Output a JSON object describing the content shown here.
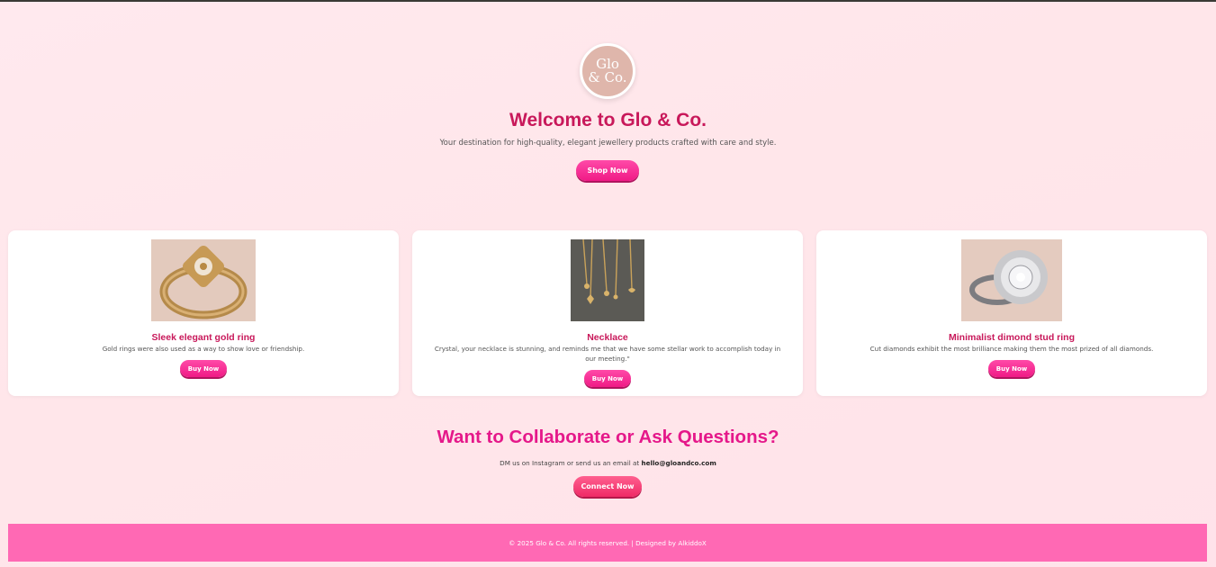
{
  "logo": {
    "line1": "Glo",
    "line2": "& Co."
  },
  "hero": {
    "title": "Welcome to Glo & Co.",
    "subtitle": "Your destination for high-quality, elegant jewellery products crafted with care and style.",
    "button": "Shop Now"
  },
  "products": [
    {
      "title": "Sleek elegant gold ring",
      "description": "Gold rings were also used as a way to show love or friendship.",
      "button": "Buy Now",
      "image": "gold-ring-image"
    },
    {
      "title": "Necklace",
      "description": "Crystal, your necklace is stunning, and reminds me that we have some stellar work to accomplish today in our meeting.\"",
      "button": "Buy Now",
      "image": "necklace-image"
    },
    {
      "title": "Minimalist dimond stud ring",
      "description": "Cut diamonds exhibit the most brilliance making them the most prized of all diamonds.",
      "button": "Buy Now",
      "image": "diamond-ring-image"
    }
  ],
  "collab": {
    "title": "Want to Collaborate or Ask Questions?",
    "text_prefix": "DM us on Instagram or send us an email at",
    "email": "hello@gloandco.com",
    "button": "Connect Now"
  },
  "footer": {
    "text": "© 2025 Glo & Co. All rights reserved. | Designed by AlkiddoX"
  },
  "colors": {
    "accent": "#c8185a",
    "button": "#f01a86",
    "footer": "#ff69b4"
  }
}
